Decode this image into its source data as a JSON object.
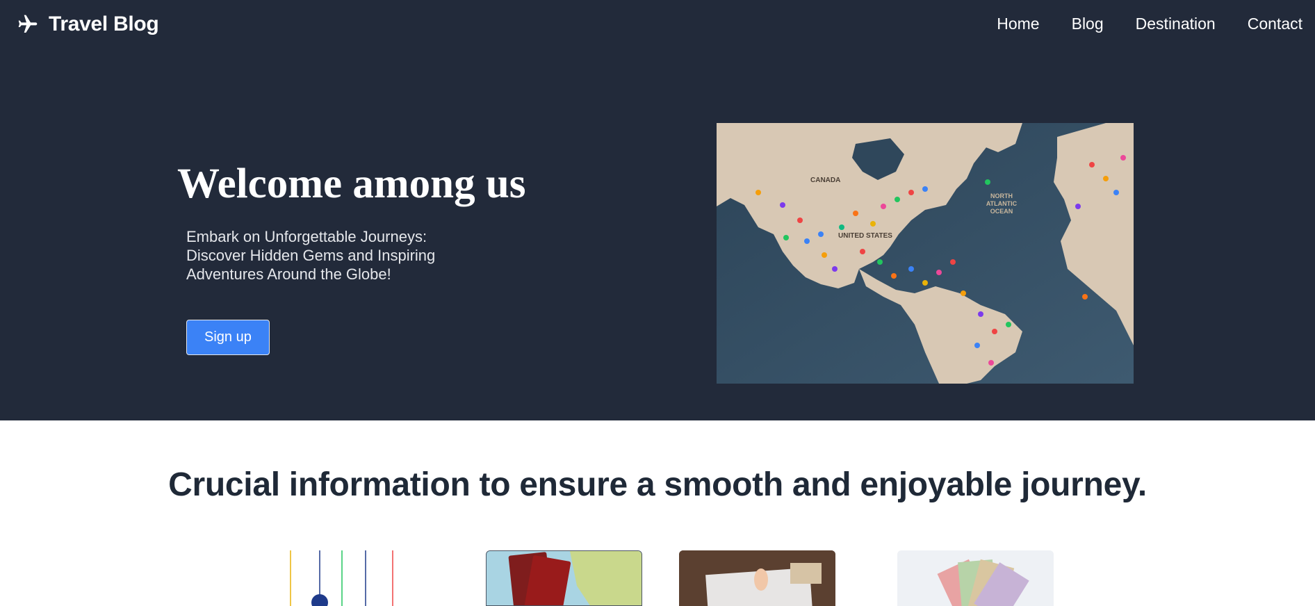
{
  "nav": {
    "brand": "Travel Blog",
    "links": [
      "Home",
      "Blog",
      "Destination",
      "Contact"
    ]
  },
  "hero": {
    "title": "Welcome among us",
    "subtitle": "Embark on Unforgettable Journeys: Discover Hidden Gems and Inspiring Adventures Around the Globe!",
    "cta_label": "Sign up",
    "map_labels": {
      "canada": "CANADA",
      "united_states": "UNITED STATES",
      "ocean_line1": "NORTH",
      "ocean_line2": "ATLANTIC",
      "ocean_line3": "OCEAN"
    }
  },
  "info": {
    "title": "Crucial information to ensure a smooth and enjoyable journey."
  },
  "colors": {
    "hero_bg": "#222a3a",
    "accent": "#3b82f6",
    "heading_dark": "#1f2937"
  },
  "icons": [
    "airplane-icon"
  ]
}
